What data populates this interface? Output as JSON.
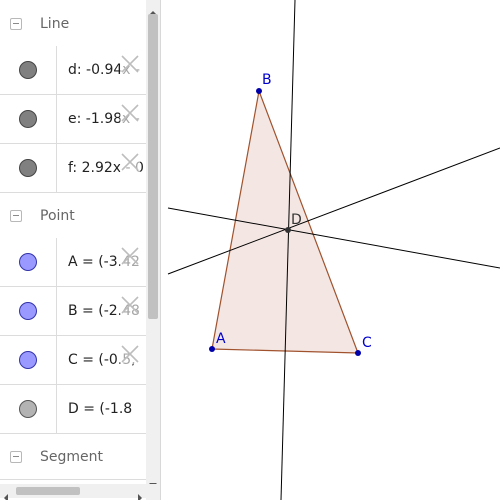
{
  "algebra": {
    "categories": {
      "line": "Line",
      "point": "Point",
      "segment": "Segment"
    },
    "lines": [
      {
        "name": "d",
        "definition": "d: -0.94x - "
      },
      {
        "name": "e",
        "definition": "e: -1.98x - "
      },
      {
        "name": "f",
        "definition": "f: 2.92x - 0"
      }
    ],
    "points": [
      {
        "name": "A",
        "definition": "A = (-3.42"
      },
      {
        "name": "B",
        "definition": "B = (-2.48"
      },
      {
        "name": "C",
        "definition": "C = (-0.5,"
      },
      {
        "name": "D",
        "definition": "D = (-1.8"
      }
    ],
    "colors": {
      "line_icon": "#808080",
      "point_icon_free": "#9999ff",
      "point_icon_dependent": "#b3b3b3"
    }
  },
  "graphics": {
    "labels": {
      "A": "A",
      "B": "B",
      "C": "C",
      "D": "D"
    },
    "colors": {
      "polygon_fill": "#f4e7e3",
      "polygon_stroke": "#a0522d",
      "point_fill": "#0000aa",
      "label": "#0000cc",
      "intersection": "#333333",
      "line": "#000000"
    }
  }
}
